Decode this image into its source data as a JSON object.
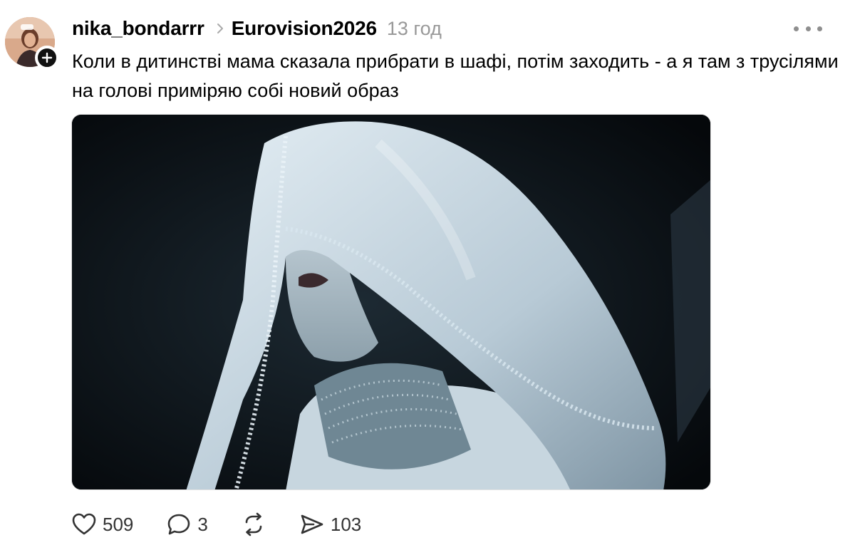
{
  "post": {
    "author": "nika_bondarrr",
    "community": "Eurovision2026",
    "time": "13 год",
    "text": "Коли в дитинстві мама сказала прибрати в шафі, потім заходить - а я там з трусілями на голові приміряю собі новий образ"
  },
  "icons": {
    "follow": "plus-icon",
    "separator": "chevron-right-icon",
    "more": "more-horizontal-icon",
    "like": "heart-icon",
    "comment": "speech-bubble-icon",
    "repost": "repost-icon",
    "share": "send-icon"
  },
  "actions": {
    "likes": "509",
    "comments": "3",
    "shares": "103"
  },
  "colors": {
    "text": "#000000",
    "muted": "#999999",
    "icon": "#333333"
  }
}
